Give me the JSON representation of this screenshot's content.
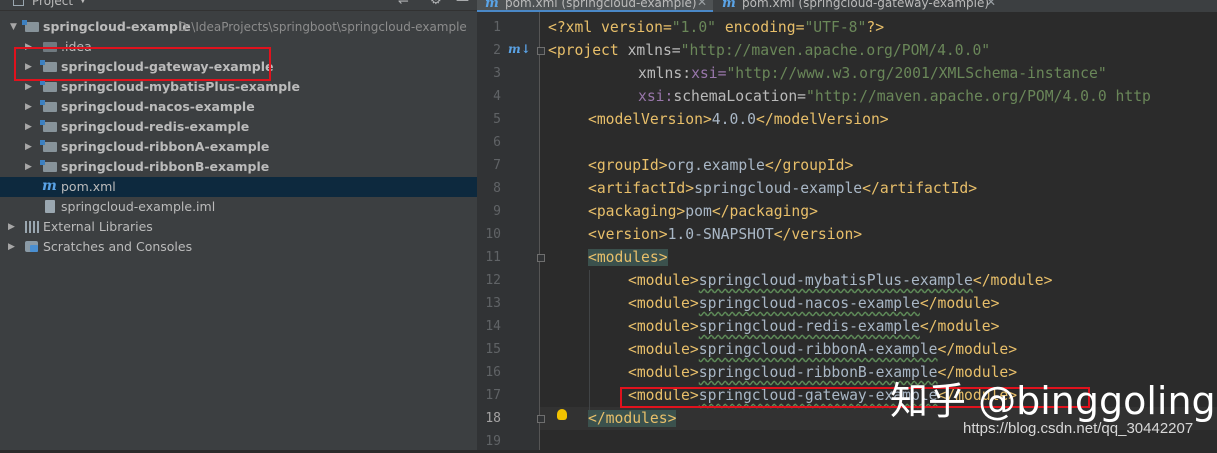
{
  "project_panel": {
    "title": "Project",
    "root": {
      "name": "springcloud-example",
      "path": "D:\\IdeaProjects\\springboot\\springcloud-example"
    },
    "items": [
      {
        "label": ".idea"
      },
      {
        "label": "springcloud-gateway-example"
      },
      {
        "label": "springcloud-mybatisPlus-example"
      },
      {
        "label": "springcloud-nacos-example"
      },
      {
        "label": "springcloud-redis-example"
      },
      {
        "label": "springcloud-ribbonA-example"
      },
      {
        "label": "springcloud-ribbonB-example"
      },
      {
        "label": "pom.xml"
      },
      {
        "label": "springcloud-example.iml"
      },
      {
        "label": "External Libraries"
      },
      {
        "label": "Scratches and Consoles"
      }
    ],
    "tool_icons": [
      "globe-icon",
      "gear-icon",
      "minimize-icon"
    ]
  },
  "editor": {
    "tabs": [
      {
        "label": "pom.xml (springcloud-example)",
        "active": true
      },
      {
        "label": "pom.xml (springcloud-gateway-example)",
        "active": false
      }
    ],
    "line_numbers": [
      "1",
      "2",
      "3",
      "4",
      "5",
      "6",
      "7",
      "8",
      "9",
      "10",
      "11",
      "12",
      "13",
      "14",
      "15",
      "16",
      "17",
      "18",
      "19"
    ],
    "lines": {
      "l1": {
        "open": "<?xml version=",
        "v1": "\"1.0\"",
        "mid": " encoding=",
        "v2": "\"UTF-8\"",
        "close": "?>"
      },
      "l2": {
        "tag": "<project ",
        "attr": "xmlns=",
        "val": "\"http://maven.apache.org/POM/4.0.0\""
      },
      "l3": {
        "ns": "xmlns:",
        "attr": "xsi=",
        "val": "\"http://www.w3.org/2001/XMLSchema-instance\""
      },
      "l4": {
        "ns": "xsi:",
        "attr": "schemaLocation=",
        "val": "\"http://maven.apache.org/POM/4.0.0 http"
      },
      "l5": {
        "open": "<modelVersion>",
        "text": "4.0.0",
        "close": "</modelVersion>"
      },
      "l7": {
        "open": "<groupId>",
        "text": "org.example",
        "close": "</groupId>"
      },
      "l8": {
        "open": "<artifactId>",
        "text": "springcloud-example",
        "close": "</artifactId>"
      },
      "l9": {
        "open": "<packaging>",
        "text": "pom",
        "close": "</packaging>"
      },
      "l10": {
        "open": "<version>",
        "text": "1.0-SNAPSHOT",
        "close": "</version>"
      },
      "l11": {
        "open": "<modules>"
      },
      "modules": [
        "springcloud-mybatisPlus-example",
        "springcloud-nacos-example",
        "springcloud-redis-example",
        "springcloud-ribbonA-example",
        "springcloud-ribbonB-example",
        "springcloud-gateway-example"
      ],
      "module_open": "<module>",
      "module_close": "</module>",
      "l18": {
        "close": "</modules>"
      }
    },
    "colors": {
      "tag": "#e8bf6a",
      "string": "#6a8759",
      "namespace": "#9876aa",
      "text": "#a9b7c6",
      "highlight": "#e0121d"
    }
  },
  "watermark": {
    "text": "知乎 @binggoling",
    "url": "https://blog.csdn.net/qq_30442207"
  }
}
